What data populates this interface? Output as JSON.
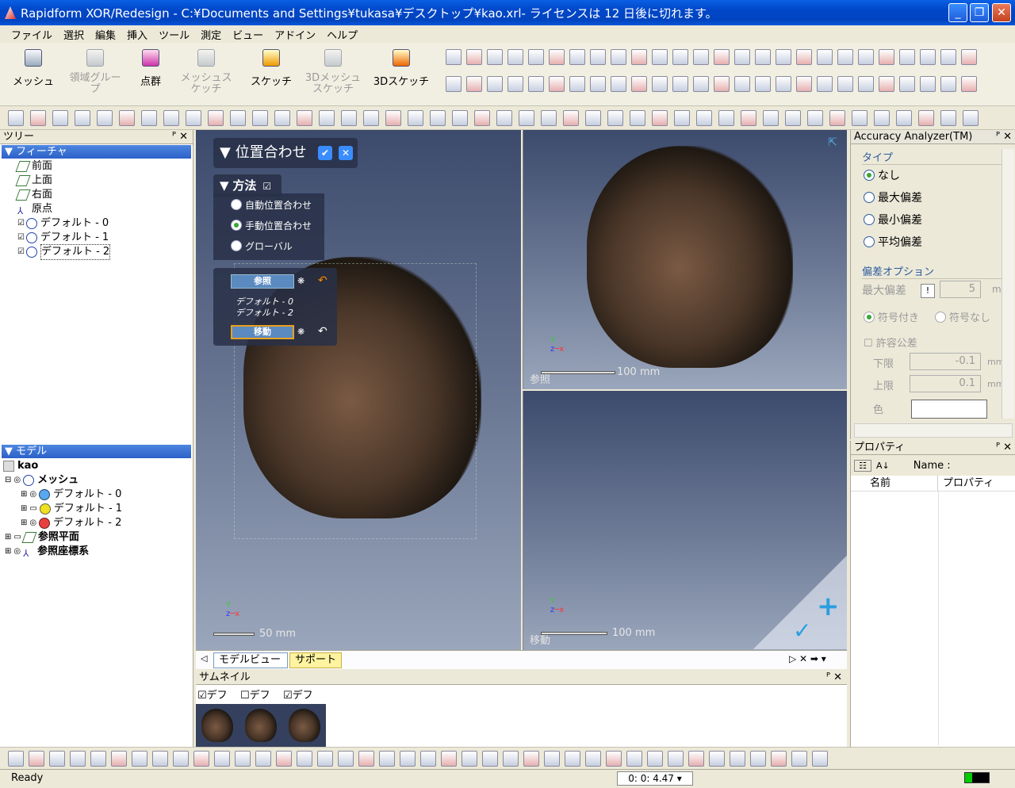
{
  "window": {
    "title": "Rapidform XOR/Redesign - C:¥Documents and Settings¥tukasa¥デスクトップ¥kao.xrl- ライセンスは 12 日後に切れます。"
  },
  "menu": [
    "ファイル",
    "選択",
    "編集",
    "挿入",
    "ツール",
    "測定",
    "ビュー",
    "アドイン",
    "ヘルプ"
  ],
  "ribbon": {
    "buttons": [
      "メッシュ",
      "領域グループ",
      "点群",
      "メッシュスケッチ",
      "スケッチ",
      "3Dメッシュスケッチ",
      "3Dスケッチ"
    ]
  },
  "tree": {
    "header": "ツリー",
    "features_header": "フィーチャ",
    "features": [
      "前面",
      "上面",
      "右面",
      "原点",
      "デフォルト - 0",
      "デフォルト - 1",
      "デフォルト - 2"
    ],
    "model_header": "モデル",
    "model_root": "kao",
    "mesh_label": "メッシュ",
    "meshes": [
      "デフォルト - 0",
      "デフォルト - 1",
      "デフォルト - 2"
    ],
    "ref_plane": "参照平面",
    "ref_coord": "参照座標系"
  },
  "align": {
    "title": "位置合わせ",
    "method_label": "方法",
    "options": [
      "自動位置合わせ",
      "手動位置合わせ",
      "グローバル"
    ],
    "selected_option": "手動位置合わせ",
    "ref_label": "参照",
    "ref_items": [
      "デフォルト - 0",
      "デフォルト - 2"
    ],
    "move_label": "移動"
  },
  "viewports": {
    "main_scale": "50 mm",
    "ref_scale": "100 mm",
    "ref_label": "参照",
    "move_scale": "100 mm",
    "move_label": "移動"
  },
  "tabs": [
    "モデルビュー",
    "サポート"
  ],
  "accuracy": {
    "title": "Accuracy Analyzer(TM)",
    "type_label": "タイプ",
    "types": [
      "なし",
      "最大偏差",
      "最小偏差",
      "平均偏差"
    ],
    "selected_type": "なし",
    "option_label": "偏差オプション",
    "max_dev_label": "最大偏差",
    "max_dev_value": "5",
    "max_dev_unit": "m",
    "signed": "符号付き",
    "unsigned": "符号なし",
    "tolerance": "許容公差",
    "lower_label": "下限",
    "lower_value": "-0.1",
    "upper_label": "上限",
    "upper_value": "0.1",
    "unit": "mm",
    "color_label": "色"
  },
  "properties": {
    "title": "プロパティ",
    "name_label": "Name :",
    "col_name": "名前",
    "col_prop": "プロパティ"
  },
  "thumbnail": {
    "title": "サムネイル",
    "items": [
      "デフォ.",
      "デフォ.",
      "デフォ."
    ]
  },
  "status": {
    "ready": "Ready",
    "time": "0: 0: 4.47"
  }
}
